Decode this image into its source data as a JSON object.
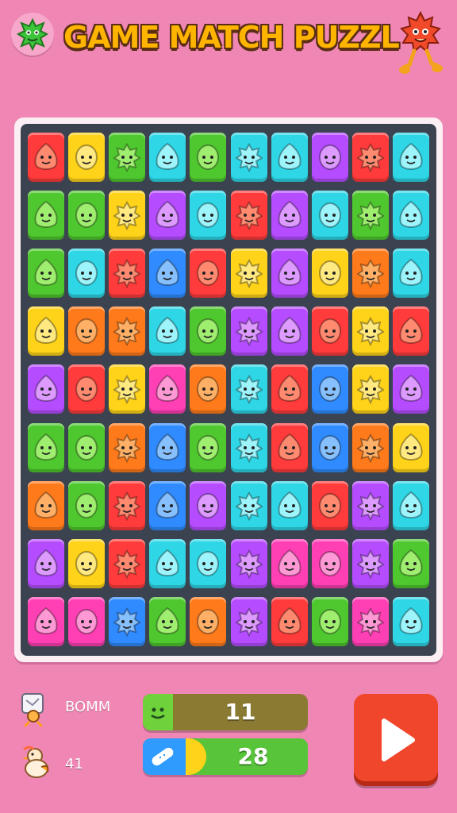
{
  "title": "GAME MATCH PUZZL",
  "colors": {
    "background": "#ef86b4",
    "board_frame": "#3c4350",
    "tile_palette": [
      "#ff3b3b",
      "#ff7a1a",
      "#ffd319",
      "#5ec72e",
      "#2ed6e6",
      "#2f9bff",
      "#b54cff",
      "#ff3fb4",
      "#1fc7a8"
    ]
  },
  "board": {
    "rows": 9,
    "cols": 10,
    "tiles": [
      [
        "red",
        "yellow",
        "green",
        "cyan",
        "green",
        "cyan",
        "cyan",
        "purple",
        "red",
        "cyan"
      ],
      [
        "green",
        "green",
        "yellow",
        "purple",
        "cyan",
        "red",
        "purple",
        "cyan",
        "green",
        "cyan"
      ],
      [
        "green",
        "cyan",
        "red",
        "blue",
        "red",
        "yellow",
        "purple",
        "yellow",
        "orange",
        "cyan"
      ],
      [
        "yellow",
        "orange",
        "orange",
        "cyan",
        "green",
        "purple",
        "purple",
        "red",
        "yellow",
        "red"
      ],
      [
        "purple",
        "red",
        "yellow",
        "magenta",
        "orange",
        "cyan",
        "red",
        "blue",
        "yellow",
        "purple"
      ],
      [
        "green",
        "green",
        "orange",
        "blue",
        "green",
        "cyan",
        "red",
        "blue",
        "orange",
        "yellow"
      ],
      [
        "orange",
        "green",
        "red",
        "blue",
        "purple",
        "cyan",
        "cyan",
        "red",
        "purple",
        "cyan"
      ],
      [
        "purple",
        "yellow",
        "red",
        "cyan",
        "cyan",
        "purple",
        "magenta",
        "magenta",
        "purple",
        "green"
      ],
      [
        "magenta",
        "magenta",
        "blue",
        "green",
        "orange",
        "purple",
        "red",
        "green",
        "magenta",
        "cyan"
      ]
    ]
  },
  "hud": {
    "row1_label": "BOMM",
    "row2_label": "41",
    "bar1_value": "11",
    "bar2_value": "28",
    "bar2_fill": 0.05
  },
  "icons": {
    "logo": "green-monster-icon",
    "mascot": "red-monster-mascot-icon",
    "bomb": "bomb-icon",
    "helper": "chick-icon",
    "bar1": "smile-icon",
    "bar2": "bandage-icon",
    "play": "play-icon"
  }
}
